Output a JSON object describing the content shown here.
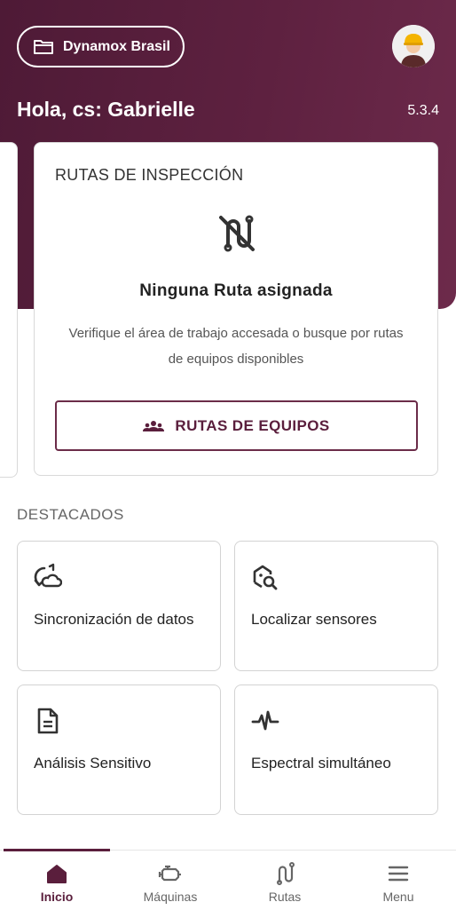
{
  "header": {
    "workspace_label": "Dynamox Brasil",
    "greeting": "Hola, cs: Gabrielle",
    "version": "5.3.4"
  },
  "routes_card": {
    "title": "RUTAS DE INSPECCIÓN",
    "empty_title": "Ninguna Ruta asignada",
    "empty_description": "Verifique el área de trabajo accesada o busque por rutas de equipos disponibles",
    "button_label": "RUTAS DE EQUIPOS"
  },
  "featured": {
    "title": "DESTACADOS",
    "items": [
      {
        "label": "Sincronización de datos",
        "icon": "sync-icon"
      },
      {
        "label": "Localizar sensores",
        "icon": "locate-sensor-icon"
      },
      {
        "label": "Análisis Sensitivo",
        "icon": "document-icon"
      },
      {
        "label": "Espectral simultáneo",
        "icon": "pulse-icon"
      }
    ]
  },
  "bottom_nav": {
    "items": [
      {
        "label": "Inicio",
        "icon": "home-icon",
        "active": true
      },
      {
        "label": "Máquinas",
        "icon": "engine-icon",
        "active": false
      },
      {
        "label": "Rutas",
        "icon": "route-icon",
        "active": false
      },
      {
        "label": "Menu",
        "icon": "menu-icon",
        "active": false
      }
    ]
  },
  "colors": {
    "brand": "#5a1e3c",
    "header_gradient_start": "#4e1a36",
    "header_gradient_end": "#6d2a4b"
  }
}
